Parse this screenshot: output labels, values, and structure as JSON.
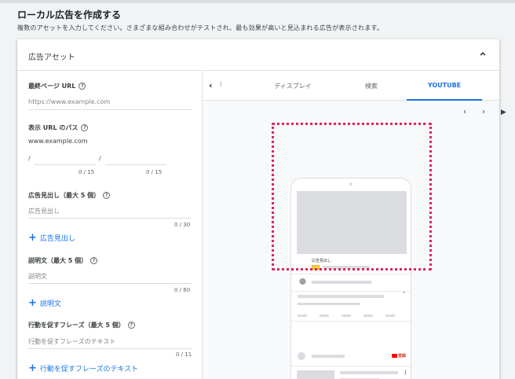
{
  "page": {
    "title": "ローカル広告を作成する",
    "subtitle": "複数のアセットを入力してください。さまざまな組み合わせがテストされ、最も効果が高いと見込まれる広告が表示されます。"
  },
  "card": {
    "title": "広告アセット",
    "collapse_icon": "chevron-up-icon"
  },
  "form": {
    "final_url": {
      "label": "最終ページ URL",
      "placeholder": "https://www.example.com"
    },
    "display_path": {
      "label": "表示 URL のパス",
      "domain": "www.example.com",
      "slash1": "/",
      "slash2": "/",
      "counter1": "0 / 15",
      "counter2": "0 / 15"
    },
    "headlines": {
      "label": "広告見出し（最大 5 個）",
      "placeholder": "広告見出し",
      "counter": "0 / 30",
      "add_label": "広告見出し"
    },
    "descriptions": {
      "label": "説明文（最大 5 個）",
      "placeholder": "説明文",
      "counter": "0 / 60",
      "add_label": "説明文"
    },
    "cta": {
      "label": "行動を促すフレーズ（最大 5 個）",
      "placeholder": "行動を促すフレーズのテキスト",
      "counter": "0 / 11",
      "add_label": "行動を促すフレーズのテキスト"
    }
  },
  "preview": {
    "tabs": [
      {
        "label": "ディスプレイ"
      },
      {
        "label": "検索"
      },
      {
        "label": "YOUTUBE"
      }
    ],
    "active_tab": "YOUTUBE",
    "more_indicator": "⁝",
    "phone": {
      "ad_label": "広告見出し",
      "ad_badge": "広告",
      "subscribe": "登録"
    },
    "colors": {
      "accent": "#1a73e8",
      "highlight": "#e0245e",
      "subscribe": "#d93025"
    }
  }
}
